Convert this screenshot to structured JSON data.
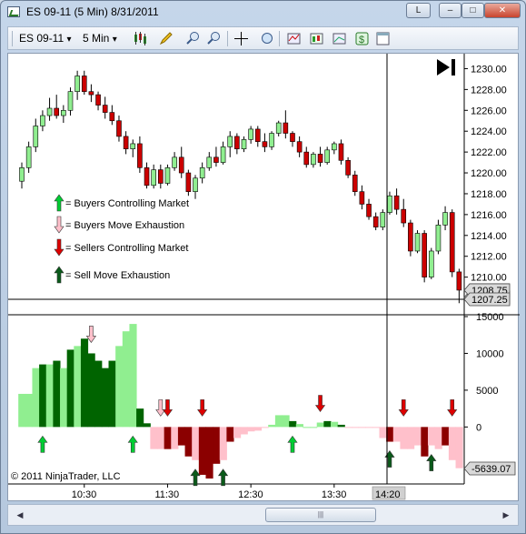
{
  "window": {
    "title": "ES 09-11 (5 Min)  8/31/2011",
    "btn_l": "L",
    "btn_min": "–",
    "btn_max": "□",
    "btn_close": "✕"
  },
  "toolbar": {
    "instrument": "ES 09-11",
    "interval": "5 Min",
    "dropdown_arrow": "▾",
    "icons": [
      "candlestick-style-icon",
      "pencil-drawing-icon",
      "zoom-in-icon",
      "zoom-out-icon",
      "crosshair-icon",
      "magnifier-icon",
      "indicators-icon",
      "strategies-icon",
      "chart-properties-icon",
      "data-box-icon",
      "dollar-icon",
      "window-properties-icon"
    ]
  },
  "colors": {
    "bull_candle": "#90ee90",
    "bear_candle": "#cc0000",
    "buyers_controlling": "#90ee90",
    "buyers_exhaustion": "#ffc0cb",
    "sellers_controlling": "#8b0000",
    "sell_exhaustion": "#006400",
    "arrow_green": "#00cc33",
    "arrow_red": "#dd0000",
    "arrow_pink": "#ffc0cb",
    "arrow_darkgreen": "#0a5a1a",
    "crosshair": "#000000"
  },
  "price_axis": {
    "ticks": [
      "1230.00",
      "1228.00",
      "1226.00",
      "1224.00",
      "1222.00",
      "1220.00",
      "1218.00",
      "1216.00",
      "1214.00",
      "1212.00",
      "1210.00"
    ],
    "marker_current": "1208.75",
    "marker_partial": "1208.75",
    "marker_crosshair": "1207.25"
  },
  "indicator_axis": {
    "ticks": [
      "15000",
      "10000",
      "5000",
      "0"
    ],
    "marker_current": "-5639.07"
  },
  "time_axis": {
    "ticks": [
      "10:30",
      "11:30",
      "12:30",
      "13:30"
    ],
    "crosshair_label": "14:20"
  },
  "legend": {
    "buyers_controlling": "= Buyers Controlling Market",
    "buyers_exhaustion": "= Buyers Move Exhaustion",
    "sellers_controlling": "= Sellers Controlling Market",
    "sell_exhaustion": "= Sell Move Exhaustion"
  },
  "copyright": "© 2011 NinjaTrader, LLC",
  "chart_data": {
    "type": "candlestick",
    "ylim": [
      1207,
      1231
    ],
    "candles": [
      {
        "o": 1219.2,
        "h": 1221.0,
        "l": 1218.5,
        "c": 1220.5
      },
      {
        "o": 1220.5,
        "h": 1223.0,
        "l": 1220.0,
        "c": 1222.5
      },
      {
        "o": 1222.5,
        "h": 1225.2,
        "l": 1222.0,
        "c": 1224.5
      },
      {
        "o": 1224.5,
        "h": 1226.0,
        "l": 1224.0,
        "c": 1225.5
      },
      {
        "o": 1225.5,
        "h": 1227.2,
        "l": 1225.0,
        "c": 1226.2
      },
      {
        "o": 1226.2,
        "h": 1227.5,
        "l": 1225.2,
        "c": 1225.5
      },
      {
        "o": 1225.5,
        "h": 1226.5,
        "l": 1224.8,
        "c": 1226.0
      },
      {
        "o": 1226.0,
        "h": 1228.2,
        "l": 1225.5,
        "c": 1227.8
      },
      {
        "o": 1227.8,
        "h": 1229.8,
        "l": 1227.0,
        "c": 1229.3
      },
      {
        "o": 1229.3,
        "h": 1229.8,
        "l": 1227.5,
        "c": 1227.8
      },
      {
        "o": 1227.8,
        "h": 1228.5,
        "l": 1226.8,
        "c": 1227.5
      },
      {
        "o": 1227.5,
        "h": 1227.8,
        "l": 1226.0,
        "c": 1226.5
      },
      {
        "o": 1226.5,
        "h": 1227.3,
        "l": 1225.2,
        "c": 1225.8
      },
      {
        "o": 1225.8,
        "h": 1226.5,
        "l": 1224.6,
        "c": 1225.0
      },
      {
        "o": 1225.0,
        "h": 1225.5,
        "l": 1223.0,
        "c": 1223.5
      },
      {
        "o": 1223.5,
        "h": 1224.0,
        "l": 1221.8,
        "c": 1222.3
      },
      {
        "o": 1222.3,
        "h": 1223.2,
        "l": 1221.5,
        "c": 1222.8
      },
      {
        "o": 1222.8,
        "h": 1223.5,
        "l": 1220.0,
        "c": 1220.5
      },
      {
        "o": 1220.5,
        "h": 1221.0,
        "l": 1218.5,
        "c": 1218.8
      },
      {
        "o": 1218.8,
        "h": 1220.8,
        "l": 1218.5,
        "c": 1220.3
      },
      {
        "o": 1220.3,
        "h": 1220.8,
        "l": 1218.5,
        "c": 1219.0
      },
      {
        "o": 1219.0,
        "h": 1220.8,
        "l": 1218.8,
        "c": 1220.5
      },
      {
        "o": 1220.5,
        "h": 1222.0,
        "l": 1220.2,
        "c": 1221.5
      },
      {
        "o": 1221.5,
        "h": 1222.5,
        "l": 1219.5,
        "c": 1220.0
      },
      {
        "o": 1220.0,
        "h": 1220.3,
        "l": 1217.8,
        "c": 1218.2
      },
      {
        "o": 1218.2,
        "h": 1219.8,
        "l": 1217.5,
        "c": 1219.5
      },
      {
        "o": 1219.5,
        "h": 1221.0,
        "l": 1219.0,
        "c": 1220.5
      },
      {
        "o": 1220.5,
        "h": 1222.0,
        "l": 1220.2,
        "c": 1221.5
      },
      {
        "o": 1221.5,
        "h": 1222.5,
        "l": 1220.6,
        "c": 1221.0
      },
      {
        "o": 1221.0,
        "h": 1223.0,
        "l": 1220.8,
        "c": 1222.5
      },
      {
        "o": 1222.5,
        "h": 1224.0,
        "l": 1221.5,
        "c": 1223.5
      },
      {
        "o": 1223.5,
        "h": 1223.8,
        "l": 1221.8,
        "c": 1222.3
      },
      {
        "o": 1222.3,
        "h": 1223.5,
        "l": 1222.0,
        "c": 1223.2
      },
      {
        "o": 1223.2,
        "h": 1224.5,
        "l": 1222.8,
        "c": 1224.2
      },
      {
        "o": 1224.2,
        "h": 1224.5,
        "l": 1222.5,
        "c": 1223.0
      },
      {
        "o": 1223.0,
        "h": 1223.8,
        "l": 1222.0,
        "c": 1222.5
      },
      {
        "o": 1222.5,
        "h": 1224.0,
        "l": 1222.2,
        "c": 1223.8
      },
      {
        "o": 1223.8,
        "h": 1225.0,
        "l": 1223.5,
        "c": 1224.8
      },
      {
        "o": 1224.8,
        "h": 1226.0,
        "l": 1223.3,
        "c": 1223.8
      },
      {
        "o": 1223.8,
        "h": 1224.0,
        "l": 1222.5,
        "c": 1223.0
      },
      {
        "o": 1223.0,
        "h": 1223.5,
        "l": 1221.5,
        "c": 1222.0
      },
      {
        "o": 1222.0,
        "h": 1222.5,
        "l": 1220.5,
        "c": 1220.8
      },
      {
        "o": 1220.8,
        "h": 1222.0,
        "l": 1220.5,
        "c": 1221.8
      },
      {
        "o": 1221.8,
        "h": 1222.5,
        "l": 1220.6,
        "c": 1221.0
      },
      {
        "o": 1221.0,
        "h": 1222.5,
        "l": 1220.8,
        "c": 1222.2
      },
      {
        "o": 1222.2,
        "h": 1223.0,
        "l": 1221.8,
        "c": 1222.8
      },
      {
        "o": 1222.8,
        "h": 1223.2,
        "l": 1220.8,
        "c": 1221.2
      },
      {
        "o": 1221.2,
        "h": 1221.5,
        "l": 1219.5,
        "c": 1219.8
      },
      {
        "o": 1219.8,
        "h": 1220.2,
        "l": 1217.8,
        "c": 1218.2
      },
      {
        "o": 1218.2,
        "h": 1218.8,
        "l": 1216.5,
        "c": 1217.0
      },
      {
        "o": 1217.0,
        "h": 1217.5,
        "l": 1215.5,
        "c": 1215.8
      },
      {
        "o": 1215.8,
        "h": 1216.2,
        "l": 1214.5,
        "c": 1214.8
      },
      {
        "o": 1214.8,
        "h": 1216.5,
        "l": 1214.5,
        "c": 1216.2
      },
      {
        "o": 1216.2,
        "h": 1218.2,
        "l": 1216.0,
        "c": 1217.8
      },
      {
        "o": 1217.8,
        "h": 1218.5,
        "l": 1216.0,
        "c": 1216.5
      },
      {
        "o": 1216.5,
        "h": 1217.5,
        "l": 1214.8,
        "c": 1215.2
      },
      {
        "o": 1215.2,
        "h": 1215.5,
        "l": 1212.0,
        "c": 1212.5
      },
      {
        "o": 1212.5,
        "h": 1214.5,
        "l": 1212.3,
        "c": 1214.2
      },
      {
        "o": 1214.2,
        "h": 1214.5,
        "l": 1209.5,
        "c": 1210.0
      },
      {
        "o": 1210.0,
        "h": 1212.8,
        "l": 1209.8,
        "c": 1212.5
      },
      {
        "o": 1212.5,
        "h": 1215.5,
        "l": 1212.2,
        "c": 1215.0
      },
      {
        "o": 1215.0,
        "h": 1216.8,
        "l": 1214.5,
        "c": 1216.2
      },
      {
        "o": 1216.2,
        "h": 1216.5,
        "l": 1210.0,
        "c": 1210.5
      },
      {
        "o": 1210.5,
        "h": 1210.8,
        "l": 1207.5,
        "c": 1208.75
      }
    ],
    "indicator": {
      "ylim": [
        -7000,
        15000
      ],
      "values": [
        4500,
        4500,
        8000,
        8500,
        8500,
        9000,
        8000,
        10500,
        11000,
        12000,
        10000,
        9000,
        8000,
        9000,
        11000,
        13000,
        14000,
        2500,
        500,
        -3000,
        -3000,
        -3000,
        -3000,
        -2500,
        -4000,
        -4500,
        -6500,
        -7000,
        -5000,
        -4500,
        -2000,
        -1500,
        -1000,
        -600,
        -500,
        0,
        300,
        1600,
        1600,
        800,
        400,
        0,
        0,
        600,
        800,
        700,
        300,
        0,
        0,
        0,
        0,
        0,
        -1500,
        -2000,
        -2000,
        -3000,
        -3000,
        -2500,
        -4000,
        -2500,
        -3000,
        -2500,
        -4500,
        -5600
      ],
      "categories": [
        "bull",
        "bull",
        "bull",
        "bullstrong",
        "bull",
        "bullstrong",
        "bull",
        "bullstrong",
        "bull",
        "bullstrong",
        "bullstrong",
        "bullstrong",
        "bullstrong",
        "bullstrong",
        "bull",
        "bull",
        "bull",
        "bullstrong",
        "bullstrong",
        "bear",
        "bear",
        "bearstrong",
        "bear",
        "bearstrong",
        "bearstrong",
        "bear",
        "bearstrong",
        "bearstrong",
        "bearstrong",
        "bear",
        "bearstrong",
        "bear",
        "bear",
        "bear",
        "bear",
        "bear",
        "bull",
        "bull",
        "bull",
        "bullstrong",
        "bull",
        "bull",
        "bull",
        "bull",
        "bullstrong",
        "bull",
        "bullstrong",
        "bear",
        "bear",
        "bear",
        "bear",
        "bear",
        "bear",
        "bearstrong",
        "bear",
        "bear",
        "bear",
        "bear",
        "bearstrong",
        "bear",
        "bear",
        "bearstrong",
        "bear",
        "bear"
      ]
    },
    "arrows": [
      {
        "type": "buy",
        "index": 3
      },
      {
        "type": "buy",
        "index": 16
      },
      {
        "type": "buyexhaust",
        "index": 10
      },
      {
        "type": "buyexhaust",
        "index": 20
      },
      {
        "type": "sell",
        "index": 21
      },
      {
        "type": "sell",
        "index": 26
      },
      {
        "type": "sellexhaust",
        "index": 25
      },
      {
        "type": "sellexhaust",
        "index": 29
      },
      {
        "type": "buy",
        "index": 39
      },
      {
        "type": "sell",
        "index": 43
      },
      {
        "type": "sellexhaust",
        "index": 53
      },
      {
        "type": "sell",
        "index": 55
      },
      {
        "type": "sellexhaust",
        "index": 59
      },
      {
        "type": "sell",
        "index": 62
      }
    ]
  }
}
